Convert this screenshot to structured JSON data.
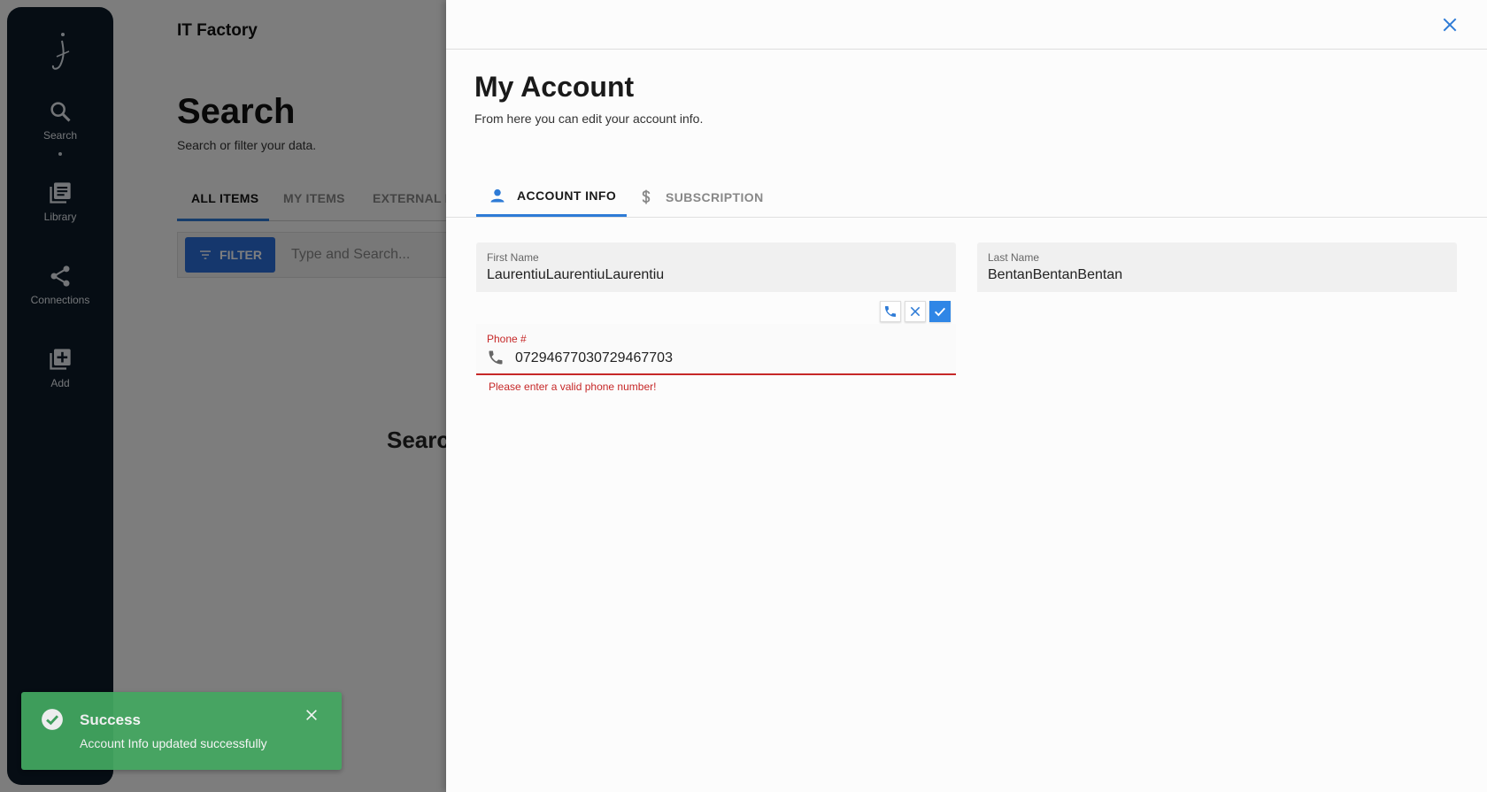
{
  "app": {
    "brand": "IT Factory",
    "nav": [
      {
        "label": "Search",
        "icon": "search-icon"
      },
      {
        "label": "Library",
        "icon": "library-icon"
      },
      {
        "label": "Connections",
        "icon": "share-icon"
      },
      {
        "label": "Add",
        "icon": "add-box-icon"
      }
    ],
    "page_title": "Search",
    "page_subtitle": "Search or filter your data.",
    "tabs": [
      "ALL ITEMS",
      "MY ITEMS",
      "EXTERNAL I"
    ],
    "filter_label": "FILTER",
    "search_placeholder": "Type and Search...",
    "center_text": "Searc"
  },
  "drawer": {
    "title": "My Account",
    "subtitle": "From here you can edit your account info.",
    "tabs": [
      {
        "label": "ACCOUNT INFO",
        "icon": "person-icon",
        "active": true
      },
      {
        "label": "SUBSCRIPTION",
        "icon": "dollar-icon",
        "active": false
      }
    ],
    "first_name": {
      "label": "First Name",
      "value": "LaurentiuLaurentiuLaurentiu"
    },
    "last_name": {
      "label": "Last Name",
      "value": "BentanBentanBentan"
    },
    "phone": {
      "label": "Phone #",
      "value": "07294677030729467703",
      "error": "Please enter a valid phone number!"
    }
  },
  "toast": {
    "title": "Success",
    "message": "Account Info updated successfully"
  },
  "colors": {
    "accent": "#2e7bd6",
    "error": "#c62828",
    "success": "#43a861",
    "nav_bg": "#0c1a28"
  }
}
